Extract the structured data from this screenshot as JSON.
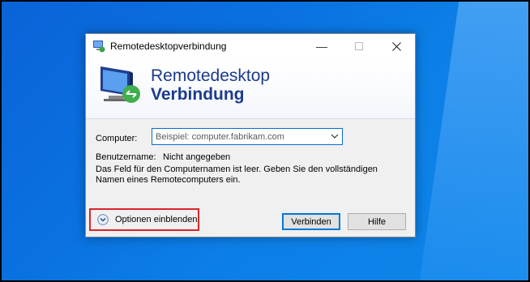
{
  "window": {
    "title": "Remotedesktopverbindung"
  },
  "banner": {
    "line1": "Remotedesktop",
    "line2": "Verbindung"
  },
  "form": {
    "computer_label": "Computer:",
    "computer_placeholder": "Beispiel: computer.fabrikam.com",
    "username_label": "Benutzername:",
    "username_value": "Nicht angegeben",
    "message": "Das Feld für den Computernamen ist leer. Geben Sie den vollständigen Namen eines Remotecomputers ein."
  },
  "footer": {
    "options_label": "Optionen einblenden",
    "connect_label": "Verbinden",
    "help_label": "Hilfe"
  },
  "colors": {
    "accent": "#0078d7",
    "highlight_border": "#d9252a",
    "banner_text": "#1c3b8c"
  },
  "icons": {
    "app": "remote-desktop-icon",
    "minimize": "minimize-icon",
    "maximize": "maximize-icon",
    "close": "close-icon",
    "dropdown": "chevron-down-icon",
    "options": "expand-options-icon"
  }
}
